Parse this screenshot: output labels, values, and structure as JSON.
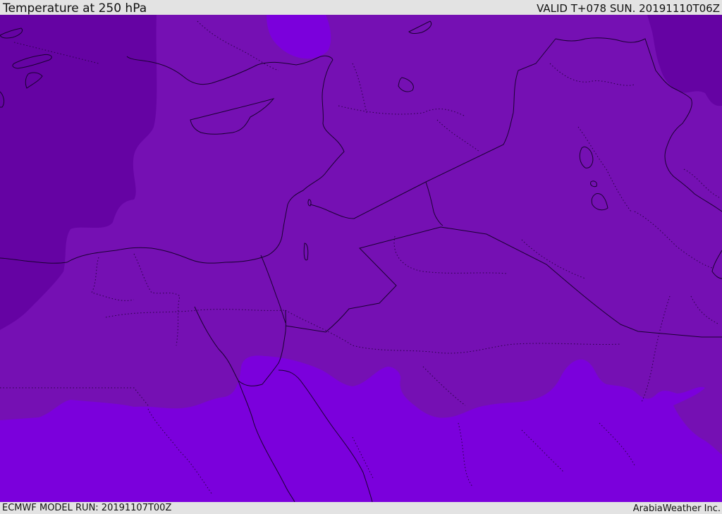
{
  "header": {
    "title": "Temperature at 250 hPa",
    "valid": "VALID T+078 SUN. 20191110T06Z"
  },
  "footer": {
    "model_run": "ECMWF MODEL RUN: 20191107T00Z",
    "credit": "ArabiaWeather Inc."
  },
  "colors": {
    "band_cold": "#6503a3",
    "band_mid": "#7510b3",
    "band_warm": "#7b00dc",
    "coastline": "#1a0032",
    "admin_border": "#2a0048",
    "frame": "#e3e3e3"
  }
}
